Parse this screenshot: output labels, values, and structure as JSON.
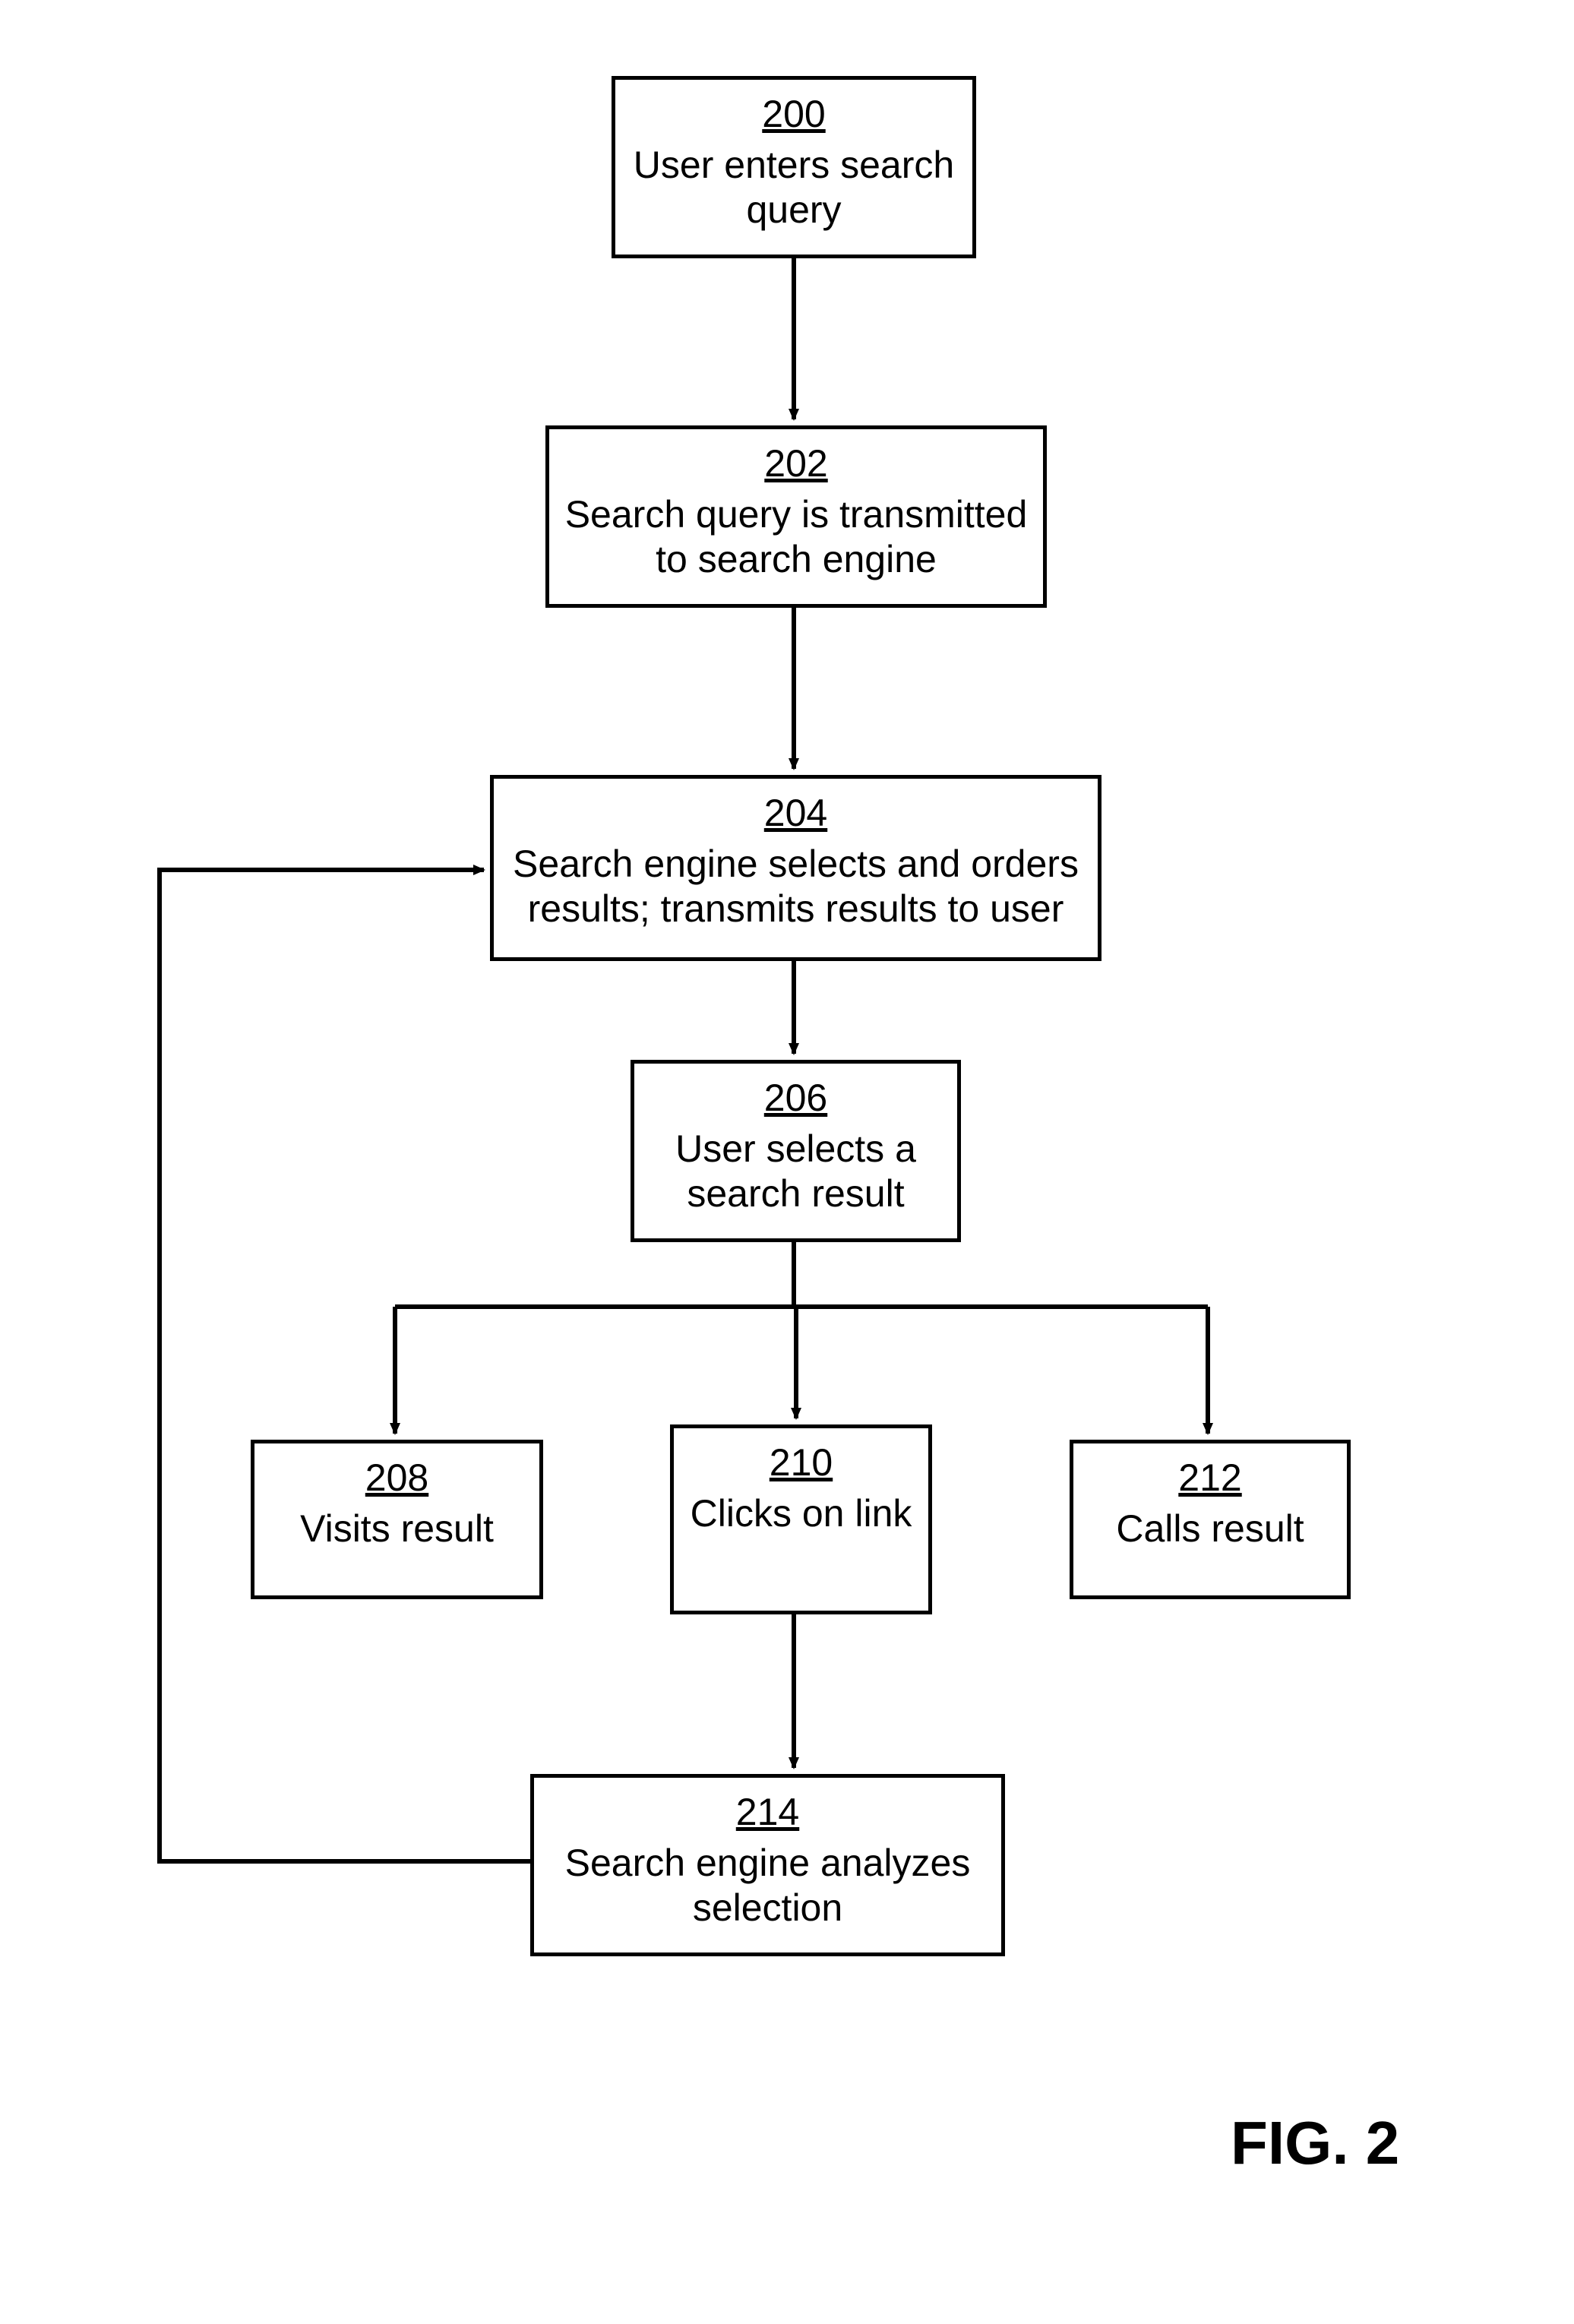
{
  "figure_label": "FIG. 2",
  "boxes": {
    "b200": {
      "num": "200",
      "txt": "User enters search query"
    },
    "b202": {
      "num": "202",
      "txt": "Search query is transmitted to search engine"
    },
    "b204": {
      "num": "204",
      "txt": "Search engine selects and orders results; transmits results to user"
    },
    "b206": {
      "num": "206",
      "txt": "User selects a search result"
    },
    "b208": {
      "num": "208",
      "txt": "Visits result"
    },
    "b210": {
      "num": "210",
      "txt": "Clicks on link"
    },
    "b212": {
      "num": "212",
      "txt": "Calls result"
    },
    "b214": {
      "num": "214",
      "txt": "Search engine analyzes selection"
    }
  }
}
